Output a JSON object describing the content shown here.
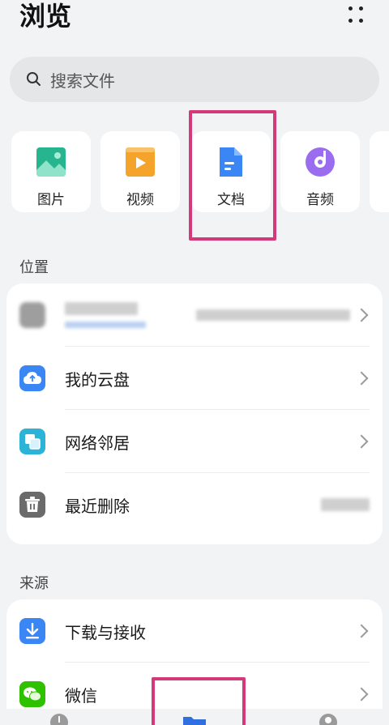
{
  "header": {
    "title": "浏览"
  },
  "search": {
    "placeholder": "搜索文件"
  },
  "categories": [
    {
      "label": "图片",
      "icon": "image-icon"
    },
    {
      "label": "视频",
      "icon": "video-icon"
    },
    {
      "label": "文档",
      "icon": "document-icon"
    },
    {
      "label": "音频",
      "icon": "audio-icon"
    }
  ],
  "sections": {
    "location": "位置",
    "source": "来源"
  },
  "location_items": [
    {
      "label": "",
      "icon": "device-icon"
    },
    {
      "label": "我的云盘",
      "icon": "cloud-drive-icon"
    },
    {
      "label": "网络邻居",
      "icon": "network-neighbor-icon"
    },
    {
      "label": "最近删除",
      "icon": "trash-icon"
    }
  ],
  "source_items": [
    {
      "label": "下载与接收",
      "icon": "download-icon"
    },
    {
      "label": "微信",
      "icon": "wechat-icon"
    }
  ],
  "colors": {
    "accent_blue": "#3a86f5",
    "highlight": "#d43a7a",
    "image_green": "#27b58f",
    "video_orange": "#f5a42b",
    "audio_purple": "#9a6cf0",
    "network_teal": "#2bb3d8",
    "trash_gray": "#6b6b6b",
    "wechat_green": "#2dc100"
  }
}
